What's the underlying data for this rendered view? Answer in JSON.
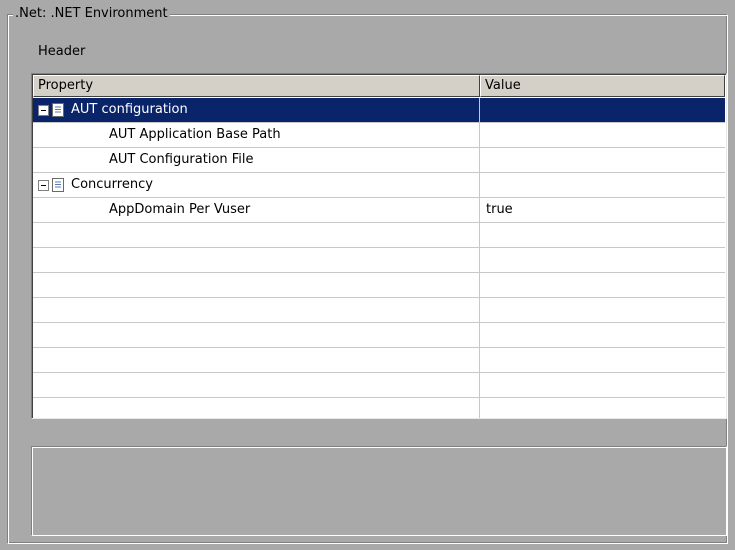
{
  "group": {
    "title": ".Net: .NET Environment"
  },
  "header_label": "Header",
  "grid": {
    "columns": [
      "Property",
      "Value"
    ],
    "rows": [
      {
        "type": "category",
        "label": "AUT configuration",
        "value": "",
        "selected": true,
        "icon": "page-icon",
        "toggle": "collapse"
      },
      {
        "type": "property",
        "label": "AUT Application Base Path",
        "value": ""
      },
      {
        "type": "property",
        "label": "AUT Configuration File",
        "value": ""
      },
      {
        "type": "category",
        "label": "Concurrency",
        "value": "",
        "icon": "page-icon",
        "toggle": "collapse"
      },
      {
        "type": "property",
        "label": "AppDomain Per Vuser",
        "value": "true"
      }
    ]
  },
  "colors": {
    "panel": "#a9a9a9",
    "selection": "#0a246a",
    "grid_bg": "#ffffff"
  }
}
